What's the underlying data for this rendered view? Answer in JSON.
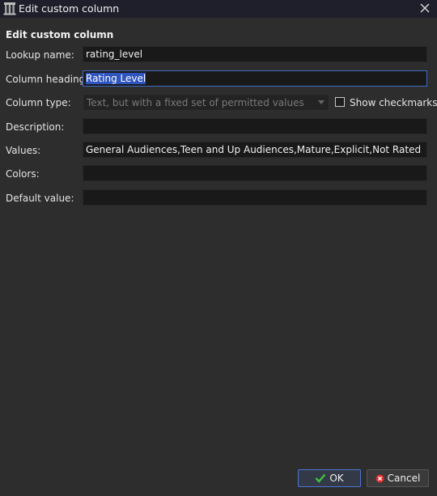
{
  "window": {
    "title": "Edit custom column",
    "icons": {
      "app": "calibre-library-icon",
      "close": "close-icon"
    }
  },
  "form": {
    "section_title": "Edit custom column",
    "lookup_name": {
      "label": "Lookup name:",
      "value": "rating_level"
    },
    "column_heading": {
      "label": "Column heading:",
      "value": "Rating Level"
    },
    "column_type": {
      "label": "Column type:",
      "value": "Text, but with a fixed set of permitted values",
      "show_checkmarks_label": "Show checkmarks",
      "show_checkmarks_checked": false
    },
    "description": {
      "label": "Description:",
      "value": ""
    },
    "values": {
      "label": "Values:",
      "value": "General Audiences,Teen and Up Audiences,Mature,Explicit,Not Rated"
    },
    "colors": {
      "label": "Colors:",
      "value": ""
    },
    "default_value": {
      "label": "Default value:",
      "value": ""
    }
  },
  "buttons": {
    "ok": {
      "label": "OK",
      "icon": "checkmark-icon"
    },
    "cancel": {
      "label": "Cancel",
      "icon": "cancel-icon"
    }
  },
  "colors": {
    "background": "#2d2d2d",
    "titlebar": "#1f1f2b",
    "field_bg": "#191919",
    "focus_border": "#3f6cc4",
    "selection": "#2f55c0",
    "ok_green": "#3fc33f",
    "cancel_red": "#e03030"
  }
}
